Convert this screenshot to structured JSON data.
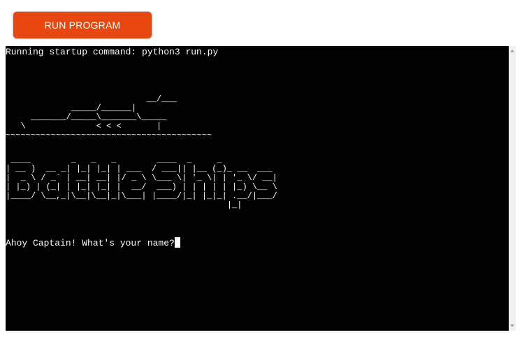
{
  "toolbar": {
    "run_label": "RUN PROGRAM"
  },
  "terminal": {
    "startup_line": "Running startup command: python3 run.py",
    "ship_art": "                            __/___\n             _____/______|\n     _______/_____\\_______\\_____\n   \\              < < <       |\n~~~~~~~~~~~~~~~~~~~~~~~~~~~~~~~~~~~~~~~~~",
    "title_art": " ____        _   _   _        ____  _     _\n| __ )  __ _| |_| |_| | ___  / ___|| |__ (_)_ __  ___\n|  _ \\ / _` | __| __| |/ _ \\ \\___ \\| '_ \\| | '_ \\/ __|\n| |_) | (_| | |_| |_| |  __/  ___) | | | | | |_) \\__ \\\n|____/ \\__,_|\\__|\\__|_|\\___| |____/|_| |_|_| .__/|___/\n                                            |_|",
    "prompt": "Ahoy Captain! What's your name?"
  },
  "colors": {
    "button": "#e8470f",
    "terminal_bg": "#000000",
    "terminal_fg": "#ffffff"
  }
}
